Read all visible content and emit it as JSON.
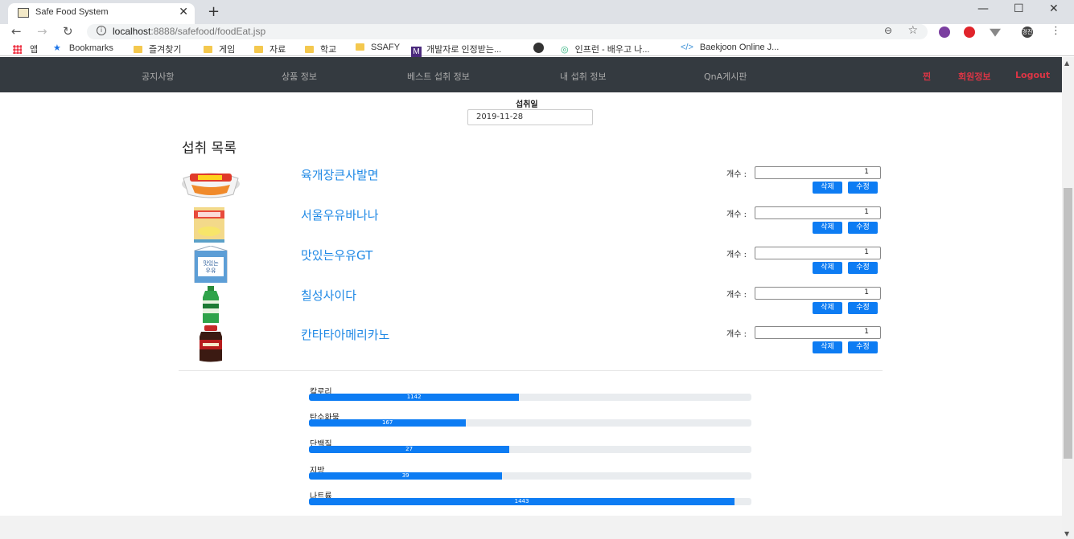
{
  "browser": {
    "tab_title": "Safe Food System",
    "url_host": "localhost",
    "url_rest": ":8888/safefood/foodEat.jsp",
    "bookmarks": [
      {
        "label": "앱",
        "icon": "apps-grid-icon"
      },
      {
        "label": "Bookmarks",
        "icon": "star-icon"
      },
      {
        "label": "즐겨찾기",
        "icon": "folder-icon"
      },
      {
        "label": "게임",
        "icon": "folder-icon"
      },
      {
        "label": "자료",
        "icon": "folder-icon"
      },
      {
        "label": "학교",
        "icon": "folder-icon"
      },
      {
        "label": "SSAFY",
        "icon": "folder-icon"
      },
      {
        "label": "개발자로 인정받는...",
        "icon": "m-logo-icon"
      },
      {
        "label": "",
        "icon": "github-icon"
      },
      {
        "label": "인프런 - 배우고 나...",
        "icon": "inflearn-icon"
      },
      {
        "label": "Baekjoon Online J...",
        "icon": "code-icon"
      }
    ],
    "profile_label": "경진"
  },
  "nav": {
    "items": [
      "공지사항",
      "상품 정보",
      "베스트 섭취 정보",
      "내 섭취 정보",
      "QnA게시판"
    ],
    "user_items": [
      "찐",
      "회원정보",
      "Logout"
    ]
  },
  "intake": {
    "date_label": "섭취일",
    "date_value": "2019-11-28",
    "section_title": "섭취 목록",
    "qty_label": "개수 :",
    "delete_label": "삭제",
    "edit_label": "수정",
    "items": [
      {
        "name": "육개장큰사발면",
        "qty": "1",
        "image": "cup-noodle-image"
      },
      {
        "name": "서울우유바나나",
        "qty": "1",
        "image": "banana-milk-image"
      },
      {
        "name": "맛있는우유GT",
        "qty": "1",
        "image": "milk-carton-image"
      },
      {
        "name": "칠성사이다",
        "qty": "1",
        "image": "cider-bottle-image"
      },
      {
        "name": "칸타타아메리카노",
        "qty": "1",
        "image": "coffee-bottle-image"
      }
    ]
  },
  "nutrition": [
    {
      "label": "칼로리",
      "value": "1142",
      "fraction": 0.475
    },
    {
      "label": "탄수화물",
      "value": "167",
      "fraction": 0.355
    },
    {
      "label": "단백질",
      "value": "27",
      "fraction": 0.453
    },
    {
      "label": "지방",
      "value": "39",
      "fraction": 0.437
    },
    {
      "label": "나트륨",
      "value": "1443",
      "fraction": 0.962
    }
  ],
  "colors": {
    "nav_bg": "#343a40",
    "accent": "#0d7cf3",
    "link": "#1e88e5",
    "danger": "#dc3545"
  }
}
